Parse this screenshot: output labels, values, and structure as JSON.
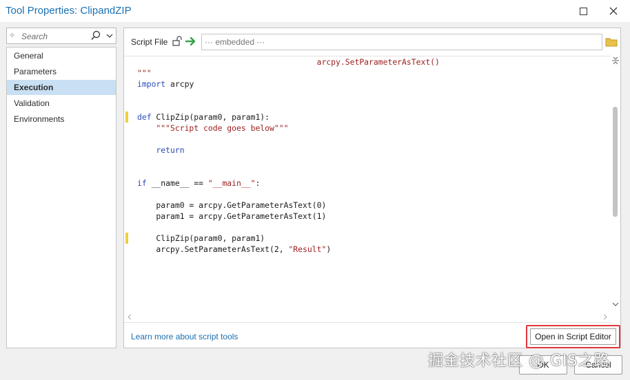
{
  "window": {
    "title": "Tool Properties: ClipandZIP",
    "maximize_icon": "maximize-icon",
    "close_icon": "close-icon"
  },
  "search": {
    "placeholder": "Search"
  },
  "nav": {
    "items": [
      {
        "label": "General",
        "selected": false
      },
      {
        "label": "Parameters",
        "selected": false
      },
      {
        "label": "Execution",
        "selected": true
      },
      {
        "label": "Validation",
        "selected": false
      },
      {
        "label": "Environments",
        "selected": false
      }
    ]
  },
  "script_file": {
    "label": "Script File",
    "placeholder": "··· embedded ···"
  },
  "code": {
    "lines": [
      {
        "kind": "plain",
        "text": "                                      arcpy.SetParameterAsText()",
        "cls": "st"
      },
      {
        "kind": "plain",
        "text": "\"\"\"",
        "cls": "st"
      },
      {
        "kind": "import",
        "kw": "import",
        "rest": " arcpy"
      },
      {
        "kind": "blank"
      },
      {
        "kind": "blank"
      },
      {
        "kind": "def",
        "kw": "def",
        "rest": " ClipZip(param0, param1):",
        "marker": true
      },
      {
        "kind": "plain",
        "text": "    \"\"\"Script code goes below\"\"\"",
        "cls": "st"
      },
      {
        "kind": "blank"
      },
      {
        "kind": "return",
        "kw": "    return",
        "rest": ""
      },
      {
        "kind": "blank"
      },
      {
        "kind": "blank"
      },
      {
        "kind": "if",
        "kw": "if",
        "rest": " __name__ == ",
        "str": "\"__main__\"",
        "tail": ":"
      },
      {
        "kind": "blank"
      },
      {
        "kind": "plain",
        "text": "    param0 = arcpy.GetParameterAsText(0)",
        "cls": ""
      },
      {
        "kind": "plain",
        "text": "    param1 = arcpy.GetParameterAsText(1)",
        "cls": ""
      },
      {
        "kind": "blank"
      },
      {
        "kind": "plain",
        "text": "    ClipZip(param0, param1)",
        "cls": "",
        "marker": true
      },
      {
        "kind": "result",
        "pre": "    arcpy.SetParameterAsText(2, ",
        "str": "\"Result\"",
        "tail": ")"
      }
    ]
  },
  "footer": {
    "learn_link": "Learn more about script tools",
    "open_editor_label": "Open in Script Editor"
  },
  "dialog": {
    "ok_label": "OK",
    "cancel_label": "Cancel"
  },
  "watermark": "掘金技术社区 @ GIS之路",
  "colors": {
    "title": "#1a6fb0",
    "selection": "#c9dff3",
    "highlight_outline": "#e2373d",
    "keyword": "#2a4bb8",
    "string": "#9b1c1c",
    "change_marker": "#f1cf3a"
  }
}
